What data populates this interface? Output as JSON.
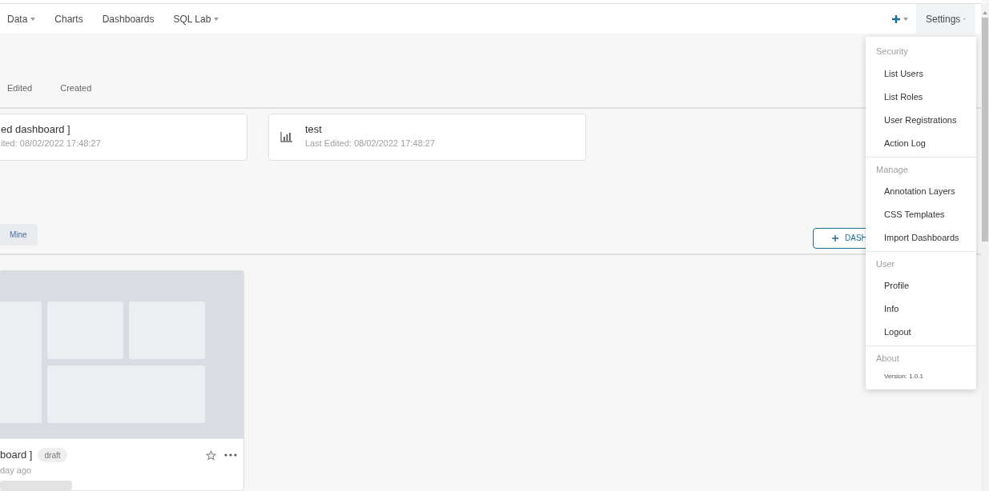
{
  "nav": {
    "items": [
      {
        "label": "Data",
        "has_caret": true
      },
      {
        "label": "Charts",
        "has_caret": false
      },
      {
        "label": "Dashboards",
        "has_caret": false
      },
      {
        "label": "SQL Lab",
        "has_caret": true
      }
    ],
    "settings": {
      "label": "Settings",
      "expanded": true
    }
  },
  "recent_tabs": [
    {
      "label": "Edited",
      "selected": false
    },
    {
      "label": "Created",
      "selected": false
    }
  ],
  "recent_cards": [
    {
      "kind": "dashboard",
      "title": "ed dashboard ]",
      "meta": "ited: 08/02/2022 17:48:27"
    },
    {
      "kind": "chart",
      "title": "test",
      "meta": "Last Edited: 08/02/2022 17:48:27"
    }
  ],
  "filters": [
    {
      "label": "Mine",
      "selected": false
    }
  ],
  "add_button": {
    "label": "DASH"
  },
  "dashboard_cards": [
    {
      "title": "board ]",
      "badge": "draft",
      "subtitle": "day ago",
      "starred": false
    }
  ],
  "settings_menu": [
    {
      "header": "Security",
      "items": [
        "List Users",
        "List Roles",
        "User Registrations",
        "Action Log"
      ]
    },
    {
      "header": "Manage",
      "items": [
        "Annotation Layers",
        "CSS Templates",
        "Import Dashboards"
      ]
    },
    {
      "header": "User",
      "items": [
        "Profile",
        "Info",
        "Logout"
      ]
    },
    {
      "header": "About",
      "version": "Version: 1.0.1"
    }
  ]
}
